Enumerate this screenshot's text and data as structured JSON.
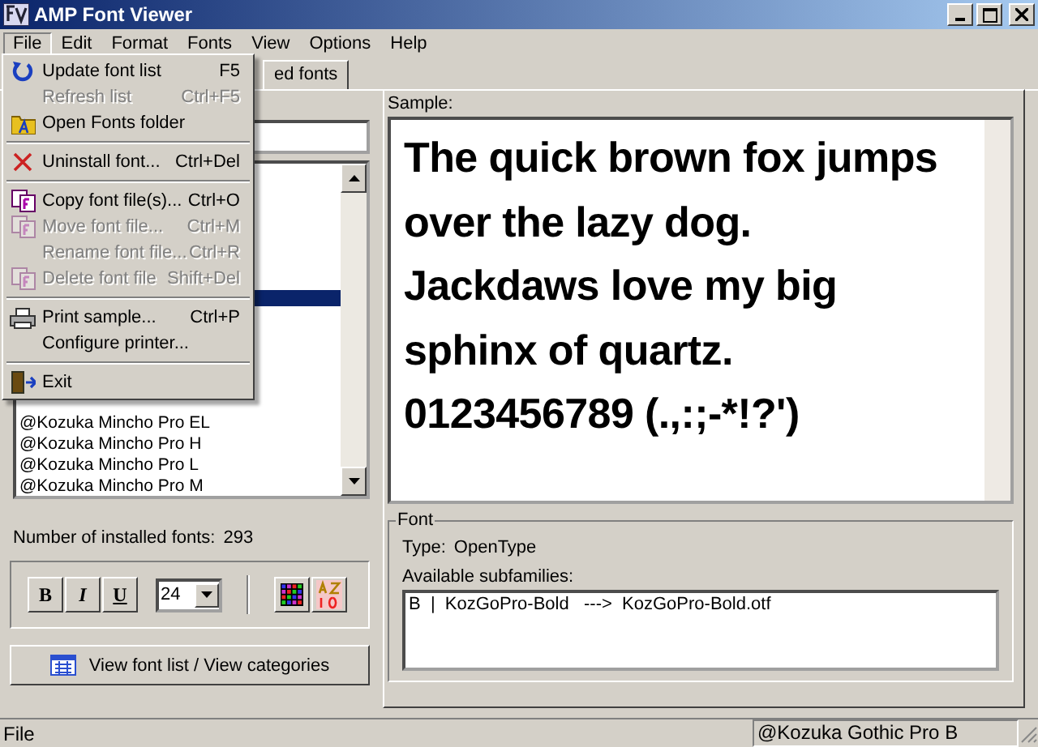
{
  "window": {
    "title": "AMP Font Viewer"
  },
  "menubar": [
    {
      "label": "File",
      "selected": true
    },
    {
      "label": "Edit",
      "selected": false
    },
    {
      "label": "Format",
      "selected": false
    },
    {
      "label": "Fonts",
      "selected": false
    },
    {
      "label": "View",
      "selected": false
    },
    {
      "label": "Options",
      "selected": false
    },
    {
      "label": "Help",
      "selected": false
    }
  ],
  "file_menu": [
    {
      "kind": "item",
      "label": "Update font list",
      "shortcut": "F5",
      "disabled": false
    },
    {
      "kind": "item",
      "label": "Refresh list",
      "shortcut": "Ctrl+F5",
      "disabled": true
    },
    {
      "kind": "item",
      "label": "Open Fonts folder",
      "disabled": false
    },
    {
      "kind": "separator"
    },
    {
      "kind": "item",
      "label": "Uninstall font...",
      "shortcut": "Ctrl+Del",
      "disabled": false
    },
    {
      "kind": "separator"
    },
    {
      "kind": "item",
      "label": "Copy font file(s)...",
      "shortcut": "Ctrl+O",
      "disabled": false
    },
    {
      "kind": "item",
      "label": "Move font file...",
      "shortcut": "Ctrl+M",
      "disabled": true
    },
    {
      "kind": "item",
      "label": "Rename font file...",
      "shortcut": "Ctrl+R",
      "disabled": true
    },
    {
      "kind": "item",
      "label": "Delete font file",
      "shortcut": "Shift+Del",
      "disabled": true
    },
    {
      "kind": "separator"
    },
    {
      "kind": "item",
      "label": "Print sample...",
      "shortcut": "Ctrl+P",
      "disabled": false
    },
    {
      "kind": "item",
      "label": "Configure printer...",
      "disabled": false
    },
    {
      "kind": "separator"
    },
    {
      "kind": "item",
      "label": "Exit",
      "disabled": false
    }
  ],
  "tabs": [
    {
      "label": "ed fonts",
      "selected": true
    }
  ],
  "font_list": [
    {
      "selected": true
    },
    {
      "label": "@Kozuka Mincho Pro EL",
      "selected": false
    },
    {
      "label": "@Kozuka Mincho Pro H",
      "selected": false
    },
    {
      "label": "@Kozuka Mincho Pro L",
      "selected": false
    },
    {
      "label": "@Kozuka Mincho Pro M",
      "selected": false
    }
  ],
  "font_count": {
    "label": "Number of installed fonts:",
    "value": "293"
  },
  "format_toolbar": {
    "bold": "B",
    "italic": "I",
    "underline": "U",
    "size": "24"
  },
  "view_button": "View font list / View categories",
  "sample": {
    "label": "Sample:",
    "lines": [
      "The quick brown fox jumps",
      "over the lazy dog.",
      "Jackdaws love my big",
      "sphinx of quartz.",
      "0123456789 (.,:;-*!?')"
    ]
  },
  "font_info": {
    "title": "Font",
    "type_label": "Type:",
    "type": "OpenType",
    "subfamilies_label": "Available subfamilies:",
    "subfamilies": [
      "B  |  KozGoPro-Bold   --->  KozGoPro-Bold.otf"
    ]
  },
  "status_bar": [
    "File",
    "@Kozuka Gothic Pro B"
  ]
}
